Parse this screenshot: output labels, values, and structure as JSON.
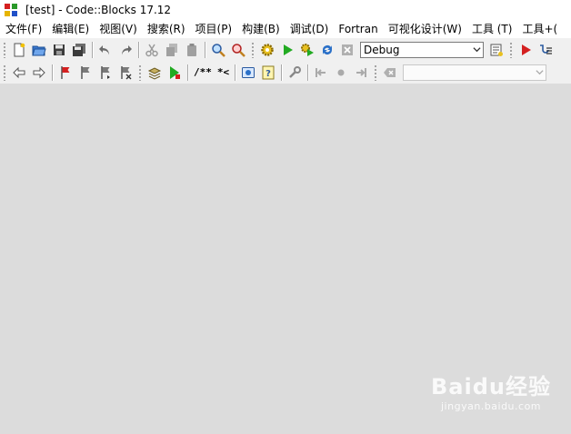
{
  "window": {
    "title": "[test] - Code::Blocks 17.12"
  },
  "menu": [
    "文件(F)",
    "编辑(E)",
    "视图(V)",
    "搜索(R)",
    "项目(P)",
    "构建(B)",
    "调试(D)",
    "Fortran",
    "可视化设计(W)",
    "工具 (T)",
    "工具+("
  ],
  "toolbar": {
    "build_target": "Debug",
    "comment_block": "/**",
    "comment_line": "*<"
  },
  "colors": {
    "workspace_bg": "#dcdcdc",
    "toolbar_bg": "#f0f0f0",
    "run_green": "#22aa22",
    "stop_red": "#d42020"
  },
  "watermark": {
    "logo": "Baidu经验",
    "url": "jingyan.baidu.com"
  }
}
